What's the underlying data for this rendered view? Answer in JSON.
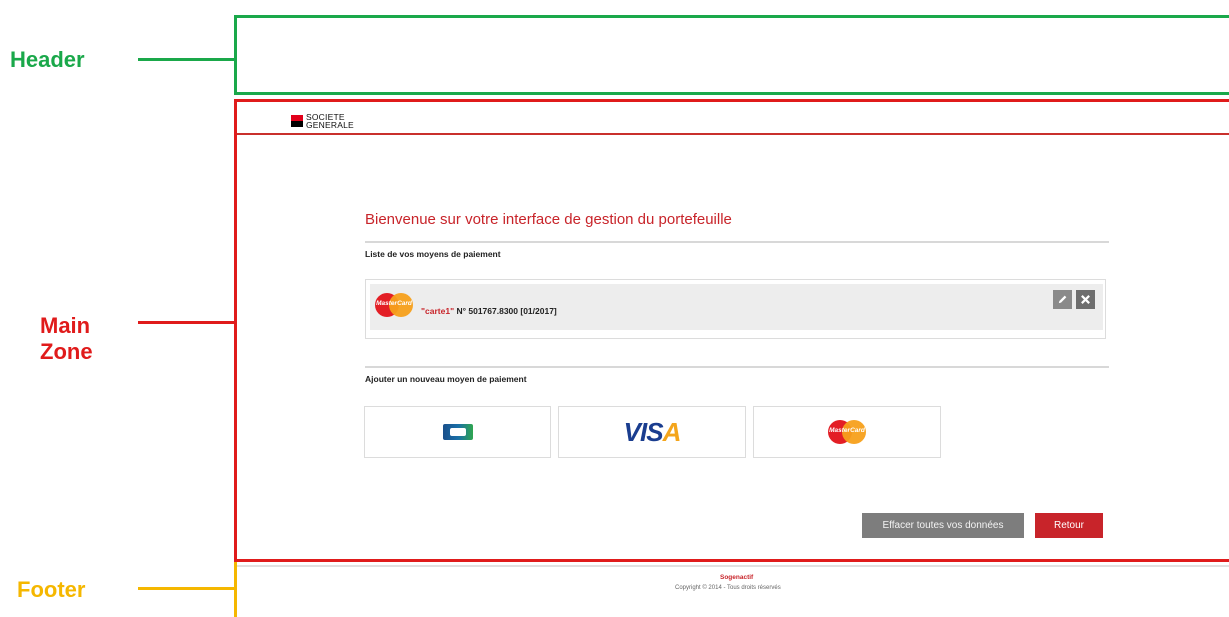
{
  "annotations": {
    "header_label": "Header",
    "main_label_line1": "Main",
    "main_label_line2": "Zone",
    "footer_label": "Footer",
    "colors": {
      "header": "#1aa84a",
      "main": "#e01b1b",
      "footer": "#f5b700"
    }
  },
  "brand": {
    "logo_line1": "SOCIETE",
    "logo_line2": "GENERALE",
    "accent": "#c8242a"
  },
  "main": {
    "title": "Bienvenue sur votre interface de gestion du portefeuille",
    "payment_list_label": "Liste de vos moyens de paiement",
    "cards": [
      {
        "brand_icon": "mastercard-icon",
        "brand_text": "MasterCard",
        "name": "\"carte1\"",
        "details": " N° 501767.8300 [01/2017]"
      }
    ],
    "add_label": "Ajouter un nouveau moyen de paiement",
    "options": [
      {
        "icon": "cb-icon"
      },
      {
        "icon": "visa-icon",
        "text_main": "VIS",
        "text_accent": "A"
      },
      {
        "icon": "mastercard-icon",
        "text": "MasterCard"
      }
    ],
    "clear_button": "Effacer toutes vos données",
    "back_button": "Retour"
  },
  "footer": {
    "brand": "Sogenactif",
    "copyright": "Copyright © 2014 - Tous droits réservés"
  }
}
